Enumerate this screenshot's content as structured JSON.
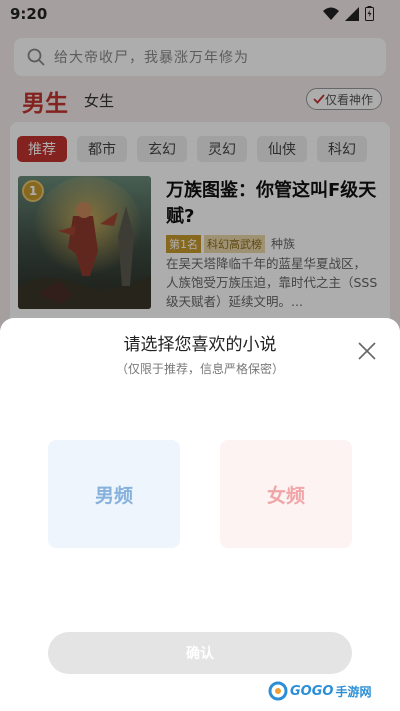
{
  "status": {
    "time": "9:20"
  },
  "search": {
    "placeholder": "给大帝收尸，我暴涨万年修为"
  },
  "gender_tabs": {
    "male": "男生",
    "female": "女生",
    "only_divine": "仅看神作"
  },
  "categories": [
    "推荐",
    "都市",
    "玄幻",
    "灵幻",
    "仙侠",
    "科幻"
  ],
  "book": {
    "rank": "1",
    "title": "万族图鉴：你管这叫F级天赋?",
    "labels": [
      "第1名",
      "科幻高武榜",
      "种族"
    ],
    "description": "在吴天塔降临千年的蓝星华夏战区，人族饱受万族压迫，靠时代之主（SSS级天赋者）延续文明。..."
  },
  "sheet": {
    "title": "请选择您喜欢的小说",
    "subtitle": "（仅限于推荐，信息严格保密）",
    "male_option": "男频",
    "female_option": "女频",
    "confirm": "确认"
  },
  "watermark": {
    "logo": "GOGO",
    "text": "手游网"
  },
  "colors": {
    "accent": "#c3332e",
    "male": "#86b1dc",
    "female": "#f0a6a8"
  }
}
